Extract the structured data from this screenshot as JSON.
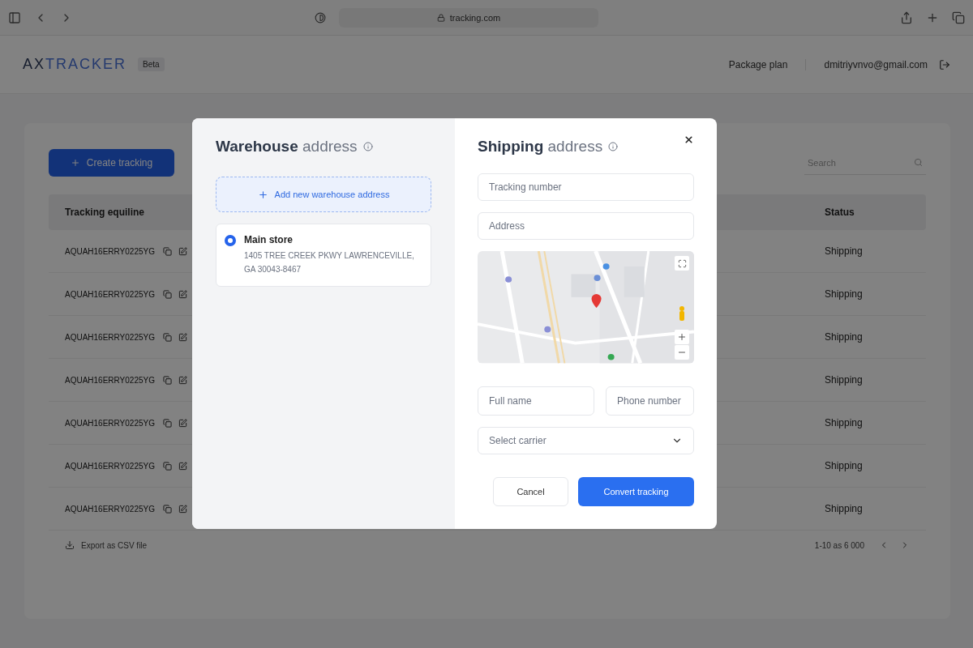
{
  "browser": {
    "url": "tracking.com"
  },
  "header": {
    "logo_prefix": "AX",
    "logo_name": "TRACKER",
    "badge": "Beta",
    "plan_link": "Package plan",
    "email": "dmitriyvnvo@gmail.com"
  },
  "toolbar": {
    "create_button": "Create tracking",
    "search": {
      "placeholder": "Search"
    }
  },
  "table": {
    "columns": [
      "Tracking equiline",
      "Status"
    ],
    "rows": [
      {
        "tracking": "AQUAH16ERRY0225YG",
        "status": "Shipping"
      },
      {
        "tracking": "AQUAH16ERRY0225YG",
        "status": "Shipping"
      },
      {
        "tracking": "AQUAH16ERRY0225YG",
        "status": "Shipping"
      },
      {
        "tracking": "AQUAH16ERRY0225YG",
        "status": "Shipping"
      },
      {
        "tracking": "AQUAH16ERRY0225YG",
        "status": "Shipping"
      },
      {
        "tracking": "AQUAH16ERRY0225YG",
        "status": "Shipping"
      },
      {
        "tracking": "AQUAH16ERRY0225YG",
        "status": "Shipping"
      }
    ]
  },
  "footer": {
    "export_link": "Export as CSV file",
    "pagination": "1-10 as 6 000"
  },
  "modal": {
    "warehouse": {
      "title": "**Warehouse** address",
      "add_button": "Add new warehouse address",
      "addresses": [
        {
          "name": "Main store",
          "address": "1405 TREE CREEK PKWY LAWRENCEVILLE, GA 30043-8467",
          "selected": true
        }
      ]
    },
    "shipping": {
      "title": "**Shipping** address",
      "fields": [
        {
          "placeholder": "Tracking number"
        },
        {
          "placeholder": "Address"
        }
      ],
      "name_field": {
        "placeholder": "Full name"
      },
      "phone_field": {
        "placeholder": "Phone number"
      },
      "carrier_select": {
        "placeholder": "Select carrier"
      },
      "cancel_button": "Cancel",
      "submit_button": "Convert tracking"
    }
  }
}
